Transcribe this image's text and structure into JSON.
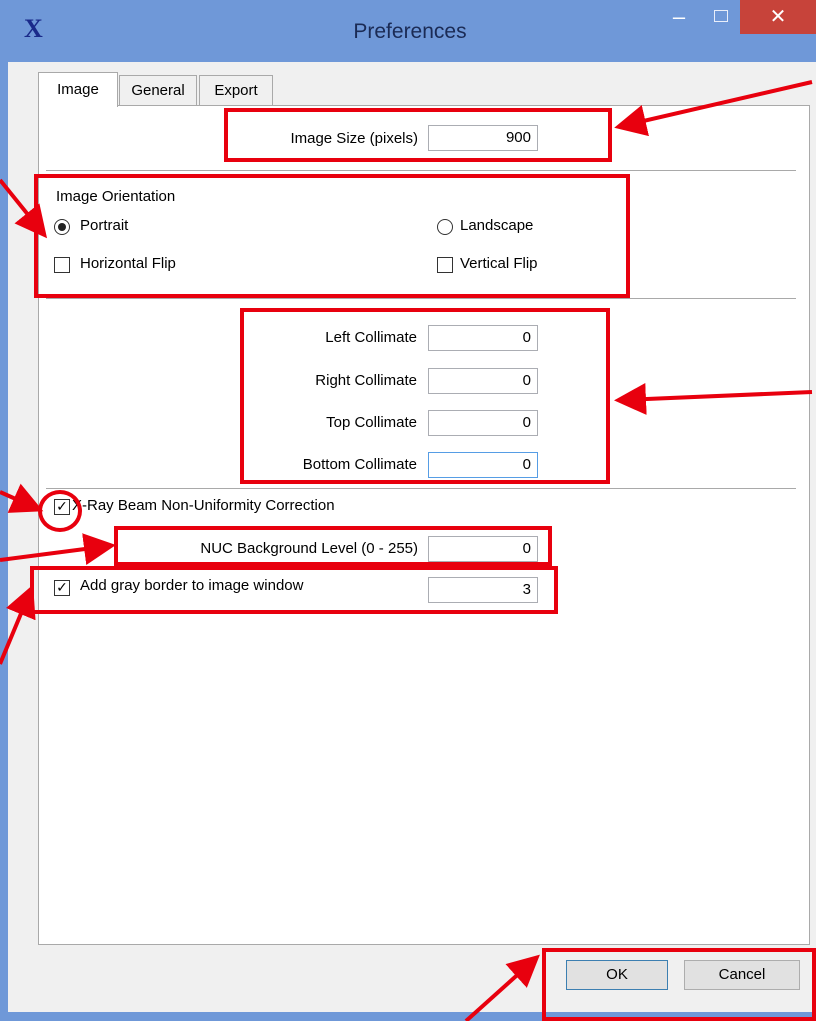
{
  "window": {
    "title": "Preferences",
    "app_icon": "X"
  },
  "tabs": [
    "Image",
    "General",
    "Export"
  ],
  "image_size": {
    "label": "Image Size (pixels)",
    "value": "900"
  },
  "orientation": {
    "heading": "Image Orientation",
    "portrait": "Portrait",
    "landscape": "Landscape",
    "horizontal_flip": "Horizontal Flip",
    "vertical_flip": "Vertical Flip",
    "portrait_selected": true,
    "landscape_selected": false,
    "horizontal_flip_checked": false,
    "vertical_flip_checked": false
  },
  "collimate": {
    "left": {
      "label": "Left Collimate",
      "value": "0"
    },
    "right": {
      "label": "Right Collimate",
      "value": "0"
    },
    "top": {
      "label": "Top Collimate",
      "value": "0"
    },
    "bottom": {
      "label": "Bottom Collimate",
      "value": "0"
    }
  },
  "nuc": {
    "checkbox_label": "X-Ray Beam Non-Uniformity Correction",
    "checked": true,
    "level_label": "NUC Background Level (0 - 255)",
    "level_value": "0"
  },
  "gray_border": {
    "label": "Add gray border to image window",
    "checked": true,
    "value": "3"
  },
  "buttons": {
    "ok": "OK",
    "cancel": "Cancel"
  },
  "colors": {
    "annotation": "#e8000e",
    "title_bar": "#6f98d8",
    "close_button": "#c7433a"
  }
}
